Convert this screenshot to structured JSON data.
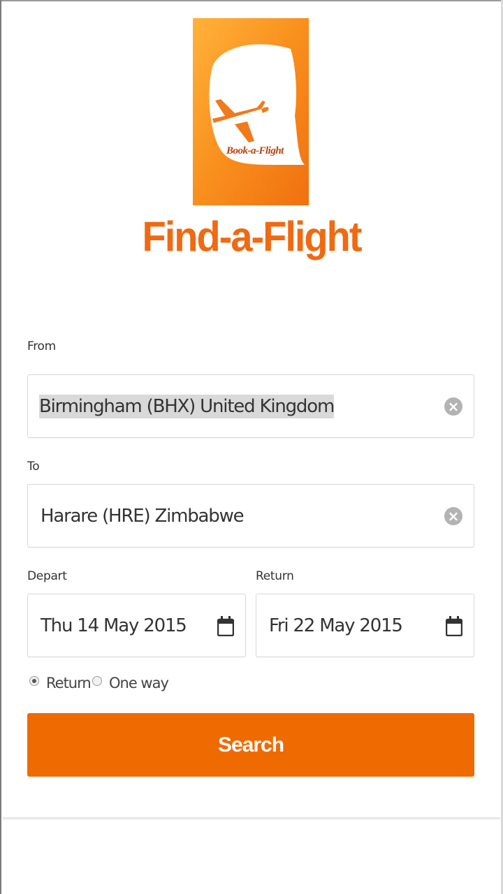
{
  "app": {
    "logo_caption": "Book-a-Flight",
    "title": "Find-a-Flight"
  },
  "form": {
    "from": {
      "label": "From",
      "value": "Birmingham (BHX) United Kingdom"
    },
    "to": {
      "label": "To",
      "value": "Harare (HRE) Zimbabwe"
    },
    "depart": {
      "label": "Depart",
      "value": "Thu 14 May 2015"
    },
    "return": {
      "label": "Return",
      "value": "Fri 22 May 2015"
    },
    "trip_type": {
      "options": [
        {
          "label": "Return",
          "selected": true
        },
        {
          "label": "One way",
          "selected": false
        }
      ]
    },
    "search_label": "Search"
  },
  "colors": {
    "brand_orange": "#ef6a00",
    "title_orange": "#ef6a12",
    "clear_icon_grey": "#b3b3b3"
  },
  "icons": {
    "clear": "close-circle-icon",
    "calendar": "calendar-icon",
    "logo": "airplane-icon"
  }
}
